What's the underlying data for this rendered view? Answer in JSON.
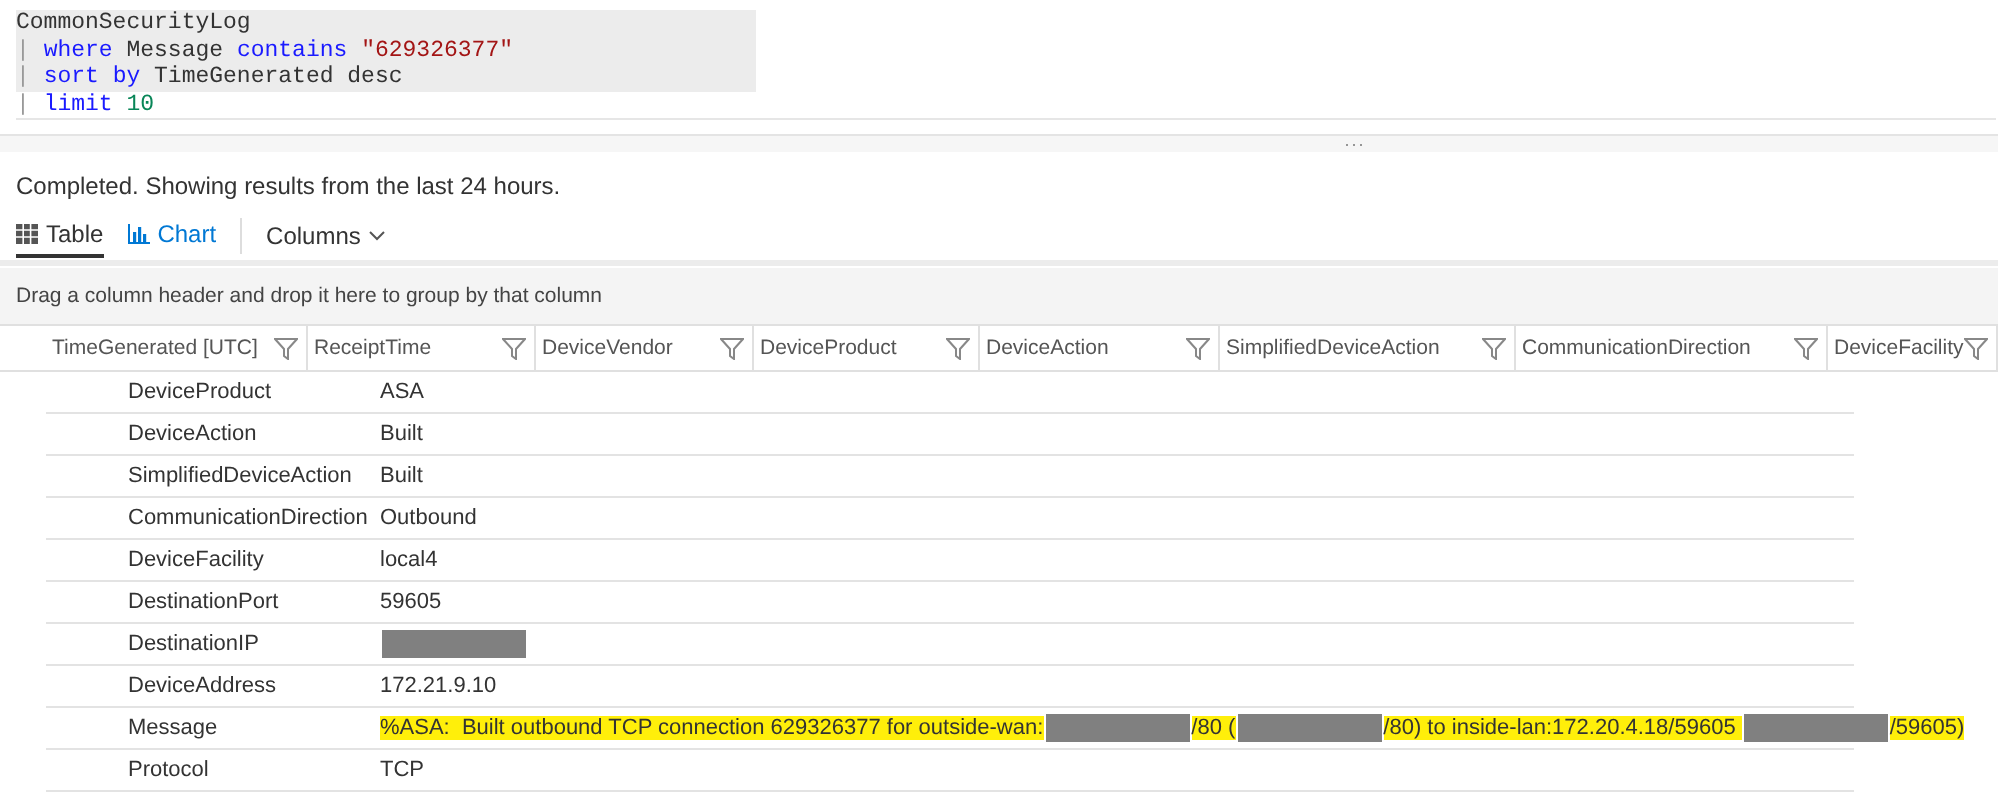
{
  "query": {
    "lines": [
      {
        "selected": true,
        "tokens": [
          {
            "kind": "plain",
            "text": "CommonSecurityLog"
          }
        ]
      },
      {
        "selected": true,
        "tokens": [
          {
            "kind": "pipe",
            "text": "| "
          },
          {
            "kind": "keyword",
            "text": "where"
          },
          {
            "kind": "plain",
            "text": " Message "
          },
          {
            "kind": "keyword",
            "text": "contains "
          },
          {
            "kind": "string",
            "text": "\"629326377\""
          }
        ]
      },
      {
        "selected": true,
        "tokens": [
          {
            "kind": "pipe",
            "text": "| "
          },
          {
            "kind": "keyword",
            "text": "sort by"
          },
          {
            "kind": "plain",
            "text": " TimeGenerated desc"
          }
        ]
      },
      {
        "selected": false,
        "tokens": [
          {
            "kind": "pipe",
            "text": "| "
          },
          {
            "kind": "keyword",
            "text": "limit "
          },
          {
            "kind": "number",
            "text": "10"
          }
        ]
      }
    ]
  },
  "splitter": {
    "handle": "..."
  },
  "status": "Completed. Showing results from the last 24 hours.",
  "view_tabs": [
    {
      "kind": "table",
      "label": "Table",
      "selected": true
    },
    {
      "kind": "chart",
      "label": "Chart",
      "selected": false
    }
  ],
  "columns_menu": {
    "label": "Columns"
  },
  "group_bar": "Drag a column header and drop it here to group by that column",
  "table": {
    "columns": [
      "TimeGenerated [UTC]",
      "ReceiptTime",
      "DeviceVendor",
      "DeviceProduct",
      "DeviceAction",
      "SimplifiedDeviceAction",
      "CommunicationDirection",
      "DeviceFacility"
    ]
  },
  "details": [
    {
      "name": "DeviceProduct",
      "value": [
        {
          "kind": "text",
          "text": "ASA"
        }
      ]
    },
    {
      "name": "DeviceAction",
      "value": [
        {
          "kind": "text",
          "text": "Built"
        }
      ]
    },
    {
      "name": "SimplifiedDeviceAction",
      "value": [
        {
          "kind": "text",
          "text": "Built"
        }
      ]
    },
    {
      "name": "CommunicationDirection",
      "value": [
        {
          "kind": "text",
          "text": "Outbound"
        }
      ]
    },
    {
      "name": "DeviceFacility",
      "value": [
        {
          "kind": "text",
          "text": "local4"
        }
      ]
    },
    {
      "name": "DestinationPort",
      "value": [
        {
          "kind": "text",
          "text": "59605"
        }
      ]
    },
    {
      "name": "DestinationIP",
      "value": [
        {
          "kind": "redacted"
        }
      ]
    },
    {
      "name": "DeviceAddress",
      "value": [
        {
          "kind": "text",
          "text": "172.21.9.10"
        }
      ]
    },
    {
      "name": "Message",
      "highlighted": true,
      "value": [
        {
          "kind": "text",
          "text": "%ASA:  Built outbound TCP connection 629326377 for outside-wan:"
        },
        {
          "kind": "redacted"
        },
        {
          "kind": "text",
          "text": "/80 ("
        },
        {
          "kind": "redacted"
        },
        {
          "kind": "text",
          "text": "/80) to inside-lan:172.20.4.18/59605 "
        },
        {
          "kind": "redacted"
        },
        {
          "kind": "text",
          "text": "/59605)"
        }
      ]
    },
    {
      "name": "Protocol",
      "value": [
        {
          "kind": "text",
          "text": "TCP"
        }
      ]
    }
  ]
}
